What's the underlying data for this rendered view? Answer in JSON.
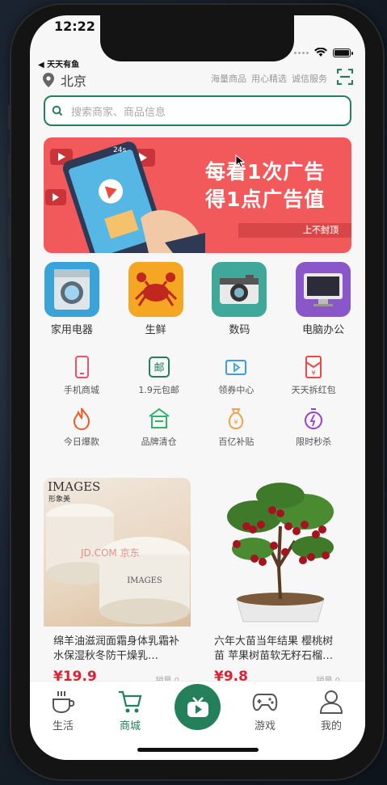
{
  "status": {
    "time": "12:22",
    "back_label": "◀ 天天有鱼"
  },
  "header": {
    "city": "北京",
    "links": [
      "海量商品",
      "用心精选",
      "诚信服务"
    ]
  },
  "search": {
    "placeholder": "搜索商家、商品信息"
  },
  "banner": {
    "line1": "每看1次广告",
    "line2": "得1点广告值",
    "tag": "上不封顶"
  },
  "categories": [
    {
      "label": "家用电器",
      "icon": "washing-machine-icon",
      "color": "#3aa3d8"
    },
    {
      "label": "生鲜",
      "icon": "crab-icon",
      "color": "#f5a623"
    },
    {
      "label": "数码",
      "icon": "camera-icon",
      "color": "#3fa89a"
    },
    {
      "label": "电脑办公",
      "icon": "monitor-icon",
      "color": "#8a56c9"
    }
  ],
  "quick": [
    {
      "label": "手机商城",
      "icon": "phone-icon",
      "color": "#e8536a"
    },
    {
      "label": "1.9元包邮",
      "icon": "post-icon",
      "color": "#23805a"
    },
    {
      "label": "领券中心",
      "icon": "coupon-icon",
      "color": "#3a9ee0"
    },
    {
      "label": "天天拆红包",
      "icon": "red-envelope-icon",
      "color": "#e84a4a"
    },
    {
      "label": "今日爆款",
      "icon": "fire-icon",
      "color": "#ee5b2a"
    },
    {
      "label": "品牌清仓",
      "icon": "store-icon",
      "color": "#2fb36a"
    },
    {
      "label": "百亿补贴",
      "icon": "money-bag-icon",
      "color": "#f0a34a"
    },
    {
      "label": "限时秒杀",
      "icon": "stopwatch-icon",
      "color": "#9a3fd0"
    }
  ],
  "products": [
    {
      "title": "绵羊油滋润面霜身体乳霜补水保湿秋冬防干燥乳…",
      "price": "¥19.9",
      "sales": "销量 0",
      "brand": "IMAGES",
      "brand_cn": "形象美",
      "watermark": "JD.COM 京东"
    },
    {
      "title": "六年大苗当年结果 樱桃树苗 苹果树苗软无籽石榴…",
      "price": "¥9.8",
      "sales": "销量 0"
    }
  ],
  "tabs": [
    {
      "label": "生活"
    },
    {
      "label": "商城"
    },
    {
      "label": ""
    },
    {
      "label": "游戏"
    },
    {
      "label": "我的"
    }
  ],
  "colors": {
    "accent": "#23805a",
    "price": "#dd2233"
  }
}
